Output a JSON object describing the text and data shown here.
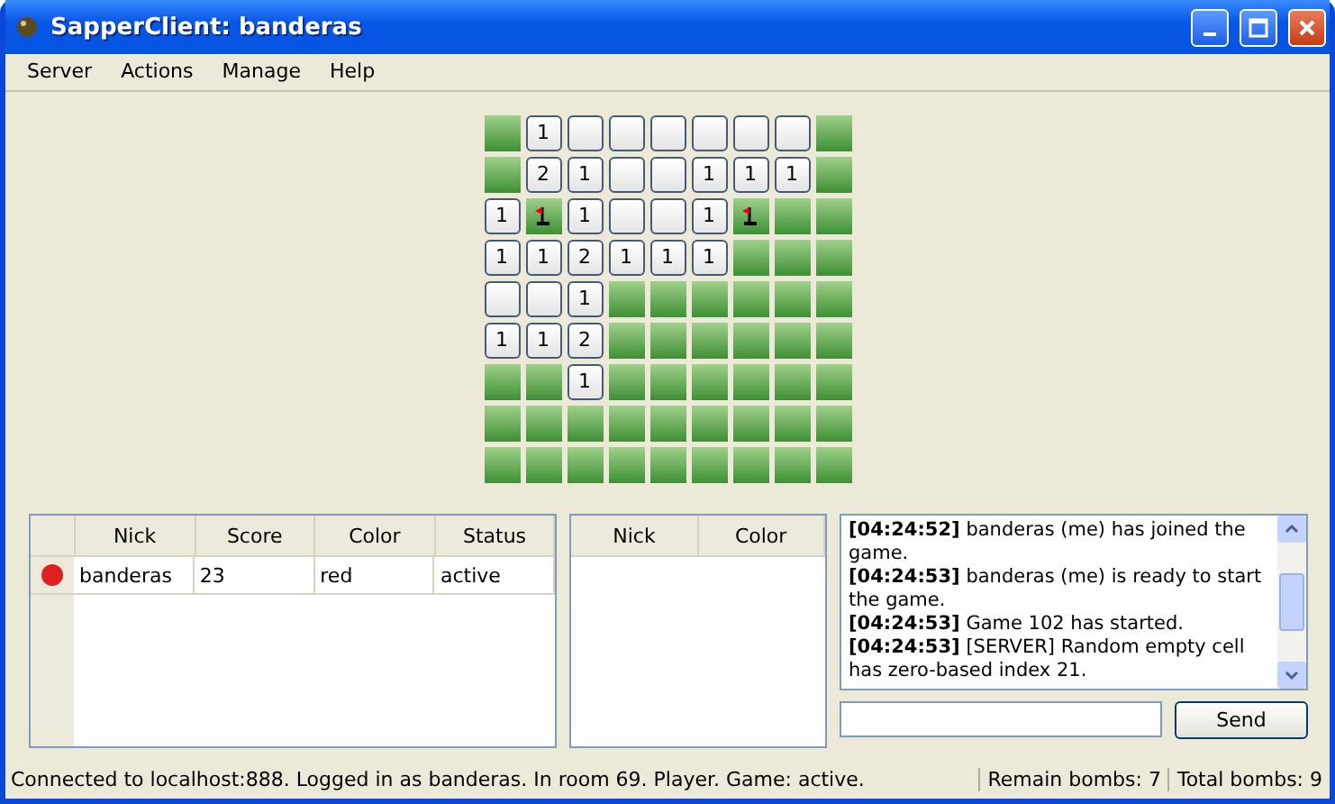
{
  "window": {
    "title": "SapperClient: banderas"
  },
  "menu": [
    "Server",
    "Actions",
    "Manage",
    "Help"
  ],
  "board": [
    [
      {
        "kind": "closed"
      },
      {
        "kind": "open",
        "text": "1"
      },
      {
        "kind": "open"
      },
      {
        "kind": "open"
      },
      {
        "kind": "open"
      },
      {
        "kind": "open"
      },
      {
        "kind": "open"
      },
      {
        "kind": "open"
      },
      {
        "kind": "closed"
      }
    ],
    [
      {
        "kind": "closed"
      },
      {
        "kind": "open",
        "text": "2"
      },
      {
        "kind": "open",
        "text": "1"
      },
      {
        "kind": "open"
      },
      {
        "kind": "open"
      },
      {
        "kind": "open",
        "text": "1"
      },
      {
        "kind": "open",
        "text": "1"
      },
      {
        "kind": "open",
        "text": "1"
      },
      {
        "kind": "closed"
      }
    ],
    [
      {
        "kind": "open",
        "text": "1"
      },
      {
        "kind": "flag"
      },
      {
        "kind": "open",
        "text": "1"
      },
      {
        "kind": "open"
      },
      {
        "kind": "open"
      },
      {
        "kind": "open",
        "text": "1"
      },
      {
        "kind": "flag"
      },
      {
        "kind": "closed"
      },
      {
        "kind": "closed"
      }
    ],
    [
      {
        "kind": "open",
        "text": "1"
      },
      {
        "kind": "open",
        "text": "1"
      },
      {
        "kind": "open",
        "text": "2"
      },
      {
        "kind": "open",
        "text": "1"
      },
      {
        "kind": "open",
        "text": "1"
      },
      {
        "kind": "open",
        "text": "1"
      },
      {
        "kind": "closed"
      },
      {
        "kind": "closed"
      },
      {
        "kind": "closed"
      }
    ],
    [
      {
        "kind": "open"
      },
      {
        "kind": "open"
      },
      {
        "kind": "open",
        "text": "1"
      },
      {
        "kind": "closed"
      },
      {
        "kind": "closed"
      },
      {
        "kind": "closed"
      },
      {
        "kind": "closed"
      },
      {
        "kind": "closed"
      },
      {
        "kind": "closed"
      }
    ],
    [
      {
        "kind": "open",
        "text": "1"
      },
      {
        "kind": "open",
        "text": "1"
      },
      {
        "kind": "open",
        "text": "2"
      },
      {
        "kind": "closed"
      },
      {
        "kind": "closed"
      },
      {
        "kind": "closed"
      },
      {
        "kind": "closed"
      },
      {
        "kind": "closed"
      },
      {
        "kind": "closed"
      }
    ],
    [
      {
        "kind": "closed"
      },
      {
        "kind": "closed"
      },
      {
        "kind": "open",
        "text": "1"
      },
      {
        "kind": "closed"
      },
      {
        "kind": "closed"
      },
      {
        "kind": "closed"
      },
      {
        "kind": "closed"
      },
      {
        "kind": "closed"
      },
      {
        "kind": "closed"
      }
    ],
    [
      {
        "kind": "closed"
      },
      {
        "kind": "closed"
      },
      {
        "kind": "closed"
      },
      {
        "kind": "closed"
      },
      {
        "kind": "closed"
      },
      {
        "kind": "closed"
      },
      {
        "kind": "closed"
      },
      {
        "kind": "closed"
      },
      {
        "kind": "closed"
      }
    ],
    [
      {
        "kind": "closed"
      },
      {
        "kind": "closed"
      },
      {
        "kind": "closed"
      },
      {
        "kind": "closed"
      },
      {
        "kind": "closed"
      },
      {
        "kind": "closed"
      },
      {
        "kind": "closed"
      },
      {
        "kind": "closed"
      },
      {
        "kind": "closed"
      }
    ]
  ],
  "players": {
    "columns": [
      "Nick",
      "Score",
      "Color",
      "Status"
    ],
    "rows": [
      {
        "cells": [
          "banderas",
          "23",
          "red",
          "active"
        ],
        "color": "#e02020"
      }
    ]
  },
  "watchers": {
    "columns": [
      "Nick",
      "Color"
    ]
  },
  "chat": {
    "log": [
      {
        "time": "[04:24:52]",
        "text": "banderas (me) has joined the game."
      },
      {
        "time": "[04:24:53]",
        "text": "banderas (me) is ready to start the game."
      },
      {
        "time": "[04:24:53]",
        "text": "Game 102 has started."
      },
      {
        "time": "[04:24:53]",
        "text": "[SERVER] Random empty cell has zero-based index 21."
      }
    ],
    "send": "Send"
  },
  "status_bar": {
    "message": "Connected to localhost:888. Logged in as banderas. In room 69. Player. Game: active.",
    "remain": "Remain bombs: 7",
    "total": "Total bombs: 9"
  }
}
